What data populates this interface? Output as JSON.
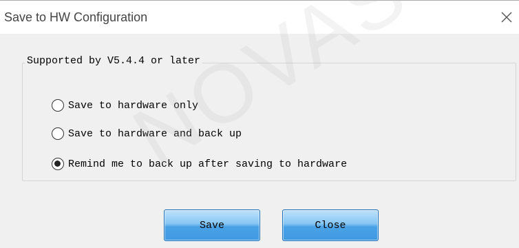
{
  "dialog": {
    "title": "Save to HW Configuration",
    "close_icon": "close-icon"
  },
  "group": {
    "legend": "Supported by V5.4.4 or later",
    "options": [
      {
        "label": "Save to hardware only",
        "checked": false
      },
      {
        "label": "Save to hardware and back up",
        "checked": false
      },
      {
        "label": "Remind me to back up after saving to hardware",
        "checked": true
      }
    ]
  },
  "buttons": {
    "save_label": "Save",
    "close_label": "Close"
  },
  "watermark": "NOVASTAR",
  "colors": {
    "dialog_background": "#f0f0f0",
    "titlebar_background": "#ffffff",
    "button_blue": "#4aa2e6",
    "button_border": "#1f6fb8"
  }
}
